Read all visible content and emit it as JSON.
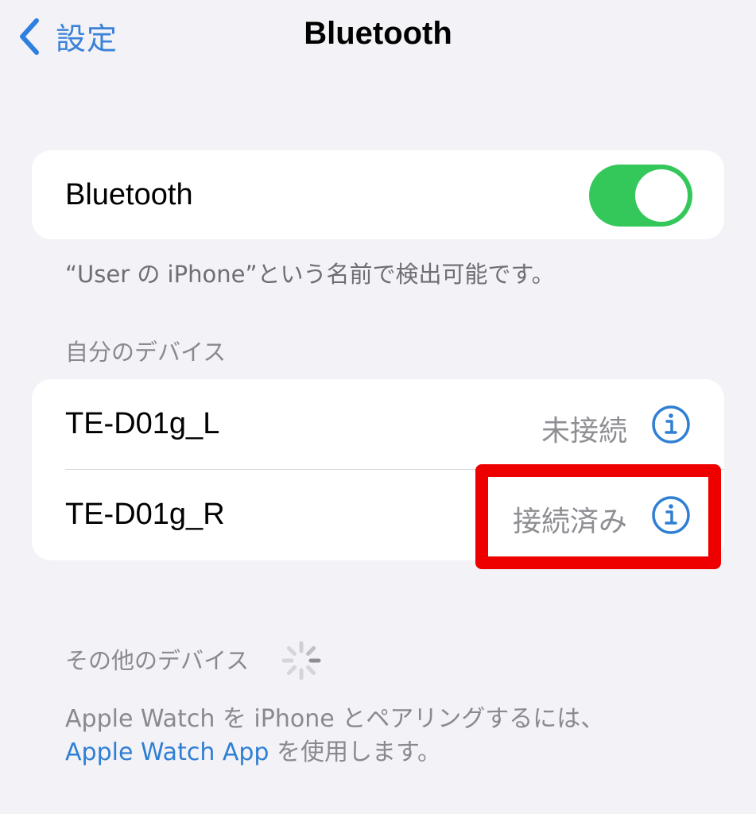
{
  "nav": {
    "back_label": "設定",
    "title": "Bluetooth"
  },
  "bluetooth_toggle": {
    "label": "Bluetooth",
    "state": "on",
    "on_color": "#34c759"
  },
  "discoverable_note": "“User の iPhone”という名前で検出可能です。",
  "my_devices": {
    "header": "自分のデバイス",
    "items": [
      {
        "name": "TE-D01g_L",
        "status": "未接続",
        "info_icon": "info-circle-icon"
      },
      {
        "name": "TE-D01g_R",
        "status": "接続済み",
        "info_icon": "info-circle-icon"
      }
    ]
  },
  "other_devices": {
    "header": "その他のデバイス",
    "loading_icon": "spinner-icon"
  },
  "watch_note": {
    "line1": "Apple Watch を iPhone とペアリングするには、",
    "link": "Apple Watch App",
    "line2_suffix": "を使用します。"
  },
  "colors": {
    "accent": "#3a82d8",
    "highlight": "#ee0000",
    "background": "#f2f2f7"
  }
}
